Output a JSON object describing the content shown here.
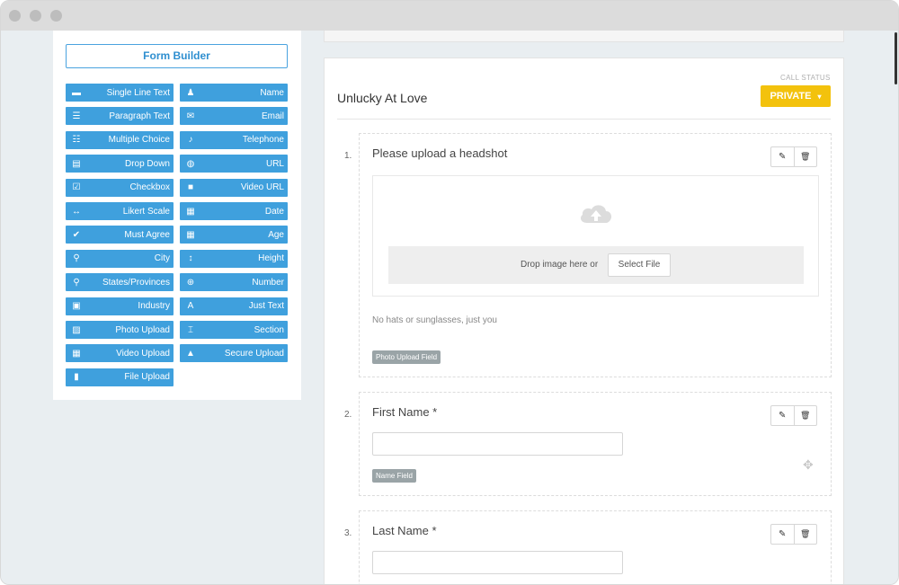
{
  "form_builder": {
    "title": "Form Builder",
    "fields_left": [
      {
        "label": "Single Line Text",
        "icon": "dash-icon",
        "glyph": "▬"
      },
      {
        "label": "Paragraph Text",
        "icon": "paragraph-icon",
        "glyph": "☰"
      },
      {
        "label": "Multiple Choice",
        "icon": "list-icon",
        "glyph": "☷"
      },
      {
        "label": "Drop Down",
        "icon": "dropdown-icon",
        "glyph": "▤"
      },
      {
        "label": "Checkbox",
        "icon": "checkbox-icon",
        "glyph": "☑"
      },
      {
        "label": "Likert Scale",
        "icon": "arrows-horizontal-icon",
        "glyph": "↔"
      },
      {
        "label": "Must Agree",
        "icon": "check-icon",
        "glyph": "✔"
      },
      {
        "label": "City",
        "icon": "map-marker-icon",
        "glyph": "⚲"
      },
      {
        "label": "States/Provinces",
        "icon": "map-marker-icon",
        "glyph": "⚲"
      },
      {
        "label": "Industry",
        "icon": "briefcase-icon",
        "glyph": "▣"
      },
      {
        "label": "Photo Upload",
        "icon": "picture-icon",
        "glyph": "▨"
      },
      {
        "label": "Video Upload",
        "icon": "film-icon",
        "glyph": "▦"
      },
      {
        "label": "File Upload",
        "icon": "file-icon",
        "glyph": "▮"
      }
    ],
    "fields_right": [
      {
        "label": "Name",
        "icon": "user-icon",
        "glyph": "♟"
      },
      {
        "label": "Email",
        "icon": "envelope-icon",
        "glyph": "✉"
      },
      {
        "label": "Telephone",
        "icon": "bell-icon",
        "glyph": "♪"
      },
      {
        "label": "URL",
        "icon": "globe-icon",
        "glyph": "◍"
      },
      {
        "label": "Video URL",
        "icon": "video-camera-icon",
        "glyph": "■"
      },
      {
        "label": "Date",
        "icon": "calendar-icon",
        "glyph": "▦"
      },
      {
        "label": "Age",
        "icon": "calendar-icon",
        "glyph": "▦"
      },
      {
        "label": "Height",
        "icon": "vertical-arrows-icon",
        "glyph": "↕"
      },
      {
        "label": "Number",
        "icon": "circle-plus-icon",
        "glyph": "⊕"
      },
      {
        "label": "Just Text",
        "icon": "font-icon",
        "glyph": "A"
      },
      {
        "label": "Section",
        "icon": "text-height-icon",
        "glyph": "⌶"
      },
      {
        "label": "Secure Upload",
        "icon": "lock-icon",
        "glyph": "▲"
      }
    ]
  },
  "card": {
    "title": "Unlucky At Love",
    "call_status_label": "CALL STATUS",
    "status_button": "PRIVATE",
    "status_caret": "▾"
  },
  "questions": [
    {
      "number": "1.",
      "title": "Please upload a headshot",
      "drop_text": "Drop image here or",
      "select_file": "Select File",
      "help": "No hats or sunglasses, just you",
      "tag": "Photo Upload Field"
    },
    {
      "number": "2.",
      "title": "First Name *",
      "tag": "Name Field"
    },
    {
      "number": "3.",
      "title": "Last Name *"
    }
  ],
  "tools": {
    "edit_glyph": "✎",
    "delete_glyph": "🗑",
    "move_glyph": "✥"
  },
  "colors": {
    "accent_blue": "#3fa0dd",
    "status_yellow": "#f3c20d"
  }
}
